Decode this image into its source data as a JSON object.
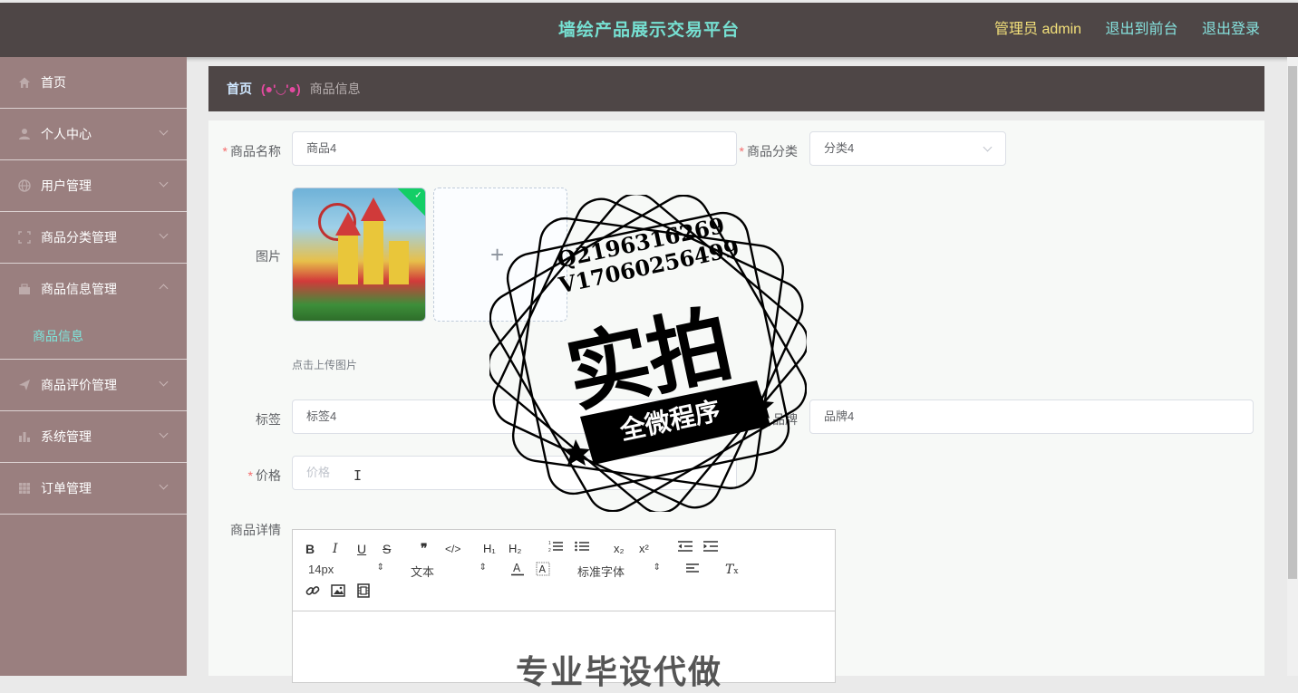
{
  "header": {
    "title": "墙绘产品展示交易平台",
    "admin_label": "管理员 admin",
    "to_frontend": "退出到前台",
    "logout": "退出登录"
  },
  "sidebar": {
    "items": [
      {
        "label": "首页",
        "icon": "home-icon"
      },
      {
        "label": "个人中心",
        "icon": "user-icon"
      },
      {
        "label": "用户管理",
        "icon": "globe-icon"
      },
      {
        "label": "商品分类管理",
        "icon": "frame-icon"
      },
      {
        "label": "商品信息管理",
        "icon": "briefcase-icon",
        "expanded": true,
        "sub": [
          {
            "label": "商品信息"
          }
        ]
      },
      {
        "label": "商品评价管理",
        "icon": "send-icon"
      },
      {
        "label": "系统管理",
        "icon": "bar-chart-icon"
      },
      {
        "label": "订单管理",
        "icon": "grid-icon"
      }
    ]
  },
  "breadcrumb": {
    "home": "首页",
    "separator": "(●'◡'●)",
    "current": "商品信息"
  },
  "form": {
    "name_label": "商品名称",
    "name_value": "商品4",
    "category_label": "商品分类",
    "category_value": "分类4",
    "image_label": "图片",
    "upload_plus": "+",
    "upload_hint": "点击上传图片",
    "tag_label": "标签",
    "tag_value": "标签4",
    "brand_label": "品牌",
    "brand_value": "品牌4",
    "price_label": "价格",
    "price_placeholder": "价格",
    "detail_label": "商品详情"
  },
  "editor": {
    "font_size": "14px",
    "header_select": "文本",
    "font_family": "标准字体",
    "content_preview": "专业毕设代做"
  },
  "watermark": {
    "line1": "Q2196316269",
    "line2": "V17060256499",
    "big": "实拍",
    "banner": "全微程序"
  },
  "colors": {
    "header_bg": "#4e4646",
    "sidebar_bg": "#9a7f7f",
    "title": "#76e0d2",
    "admin": "#f3e07a",
    "active_sub": "#7ee7dd"
  }
}
